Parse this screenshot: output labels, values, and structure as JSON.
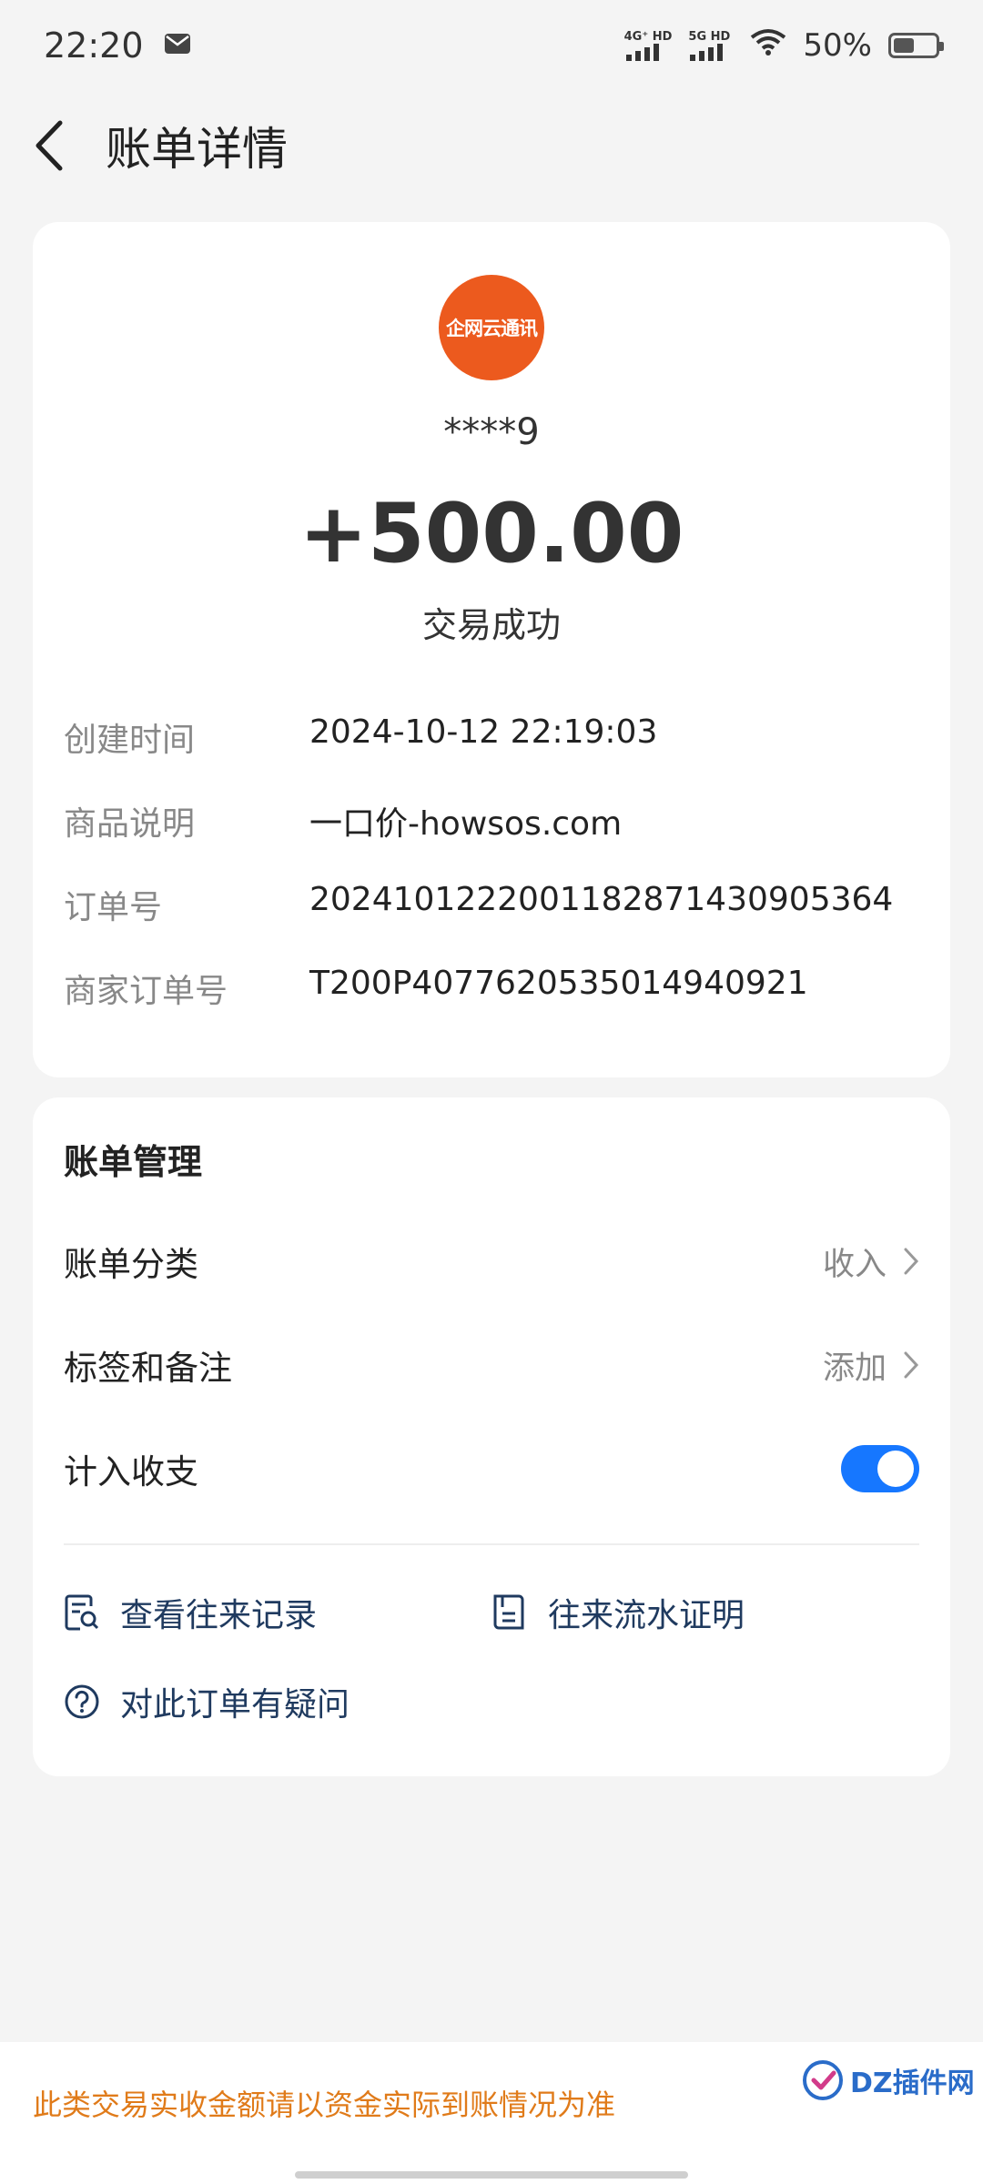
{
  "status_bar": {
    "time": "22:20",
    "signal1_label": "4G⁺ HD",
    "signal2_label": "5G HD",
    "battery": "50%",
    "battery_level": 0.5
  },
  "header": {
    "title": "账单详情"
  },
  "transaction": {
    "avatar_text": "企网云通讯",
    "avatar_color": "#ec5a1e",
    "account": "****9",
    "amount": "+500.00",
    "status": "交易成功",
    "details": [
      {
        "label": "创建时间",
        "value": "2024-10-12 22:19:03"
      },
      {
        "label": "商品说明",
        "value": "一口价-howsos.com"
      },
      {
        "label": "订单号",
        "value": "2024101222001182871430905364"
      },
      {
        "label": "商家订单号",
        "value": "T200P4077620535014940921"
      }
    ]
  },
  "manage": {
    "title": "账单管理",
    "rows": [
      {
        "label": "账单分类",
        "value": "收入"
      },
      {
        "label": "标签和备注",
        "value": "添加"
      },
      {
        "label": "计入收支",
        "toggle_on": true
      }
    ],
    "links": [
      {
        "label": "查看往来记录",
        "icon": "records-search-icon"
      },
      {
        "label": "往来流水证明",
        "icon": "statement-proof-icon"
      },
      {
        "label": "对此订单有疑问",
        "icon": "question-icon"
      }
    ]
  },
  "footer": {
    "note": "此类交易实收金额请以资金实际到账情况为准",
    "watermark": "DZ插件网"
  },
  "colors": {
    "accent": "#1677ff",
    "note": "#e07b1a",
    "link": "#1f3a5f"
  }
}
